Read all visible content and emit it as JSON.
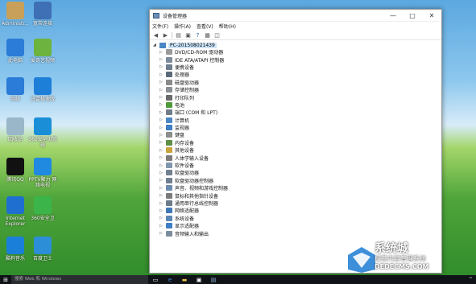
{
  "desktop": {
    "icons": [
      {
        "label": "Administr...",
        "color": "#c9a05a",
        "glyph": "user-folder"
      },
      {
        "label": "宽带连接",
        "color": "#3f6fb5",
        "glyph": "computer"
      },
      {
        "label": "此电脑",
        "color": "#2b7bd8",
        "glyph": "pc"
      },
      {
        "label": "爱奇艺视频",
        "color": "#6db33f",
        "glyph": "iqiyi"
      },
      {
        "label": "网络",
        "color": "#2b7bd8",
        "glyph": "network"
      },
      {
        "label": "迅雷极速版",
        "color": "#1e7fd8",
        "glyph": "bird"
      },
      {
        "label": "回收站",
        "color": "#9ab7c9",
        "glyph": "recycle"
      },
      {
        "label": "360安全浏览器",
        "color": "#1a8fd8",
        "glyph": "e"
      },
      {
        "label": "腾讯QQ",
        "color": "#111111",
        "glyph": "qq"
      },
      {
        "label": "PPTV聚力 网络电视",
        "color": "#1f8ae0",
        "glyph": "pptv"
      },
      {
        "label": "Internet Explorer",
        "color": "#1f6fd0",
        "glyph": "ie"
      },
      {
        "label": "360安全卫",
        "color": "#3bb54a",
        "glyph": "shield"
      },
      {
        "label": "酷狗音乐",
        "color": "#1a7fd8",
        "glyph": "kugou"
      },
      {
        "label": "百度卫士",
        "color": "#2d8ed8",
        "glyph": "shield"
      }
    ]
  },
  "window": {
    "title": "设备管理器",
    "controls": {
      "min": "—",
      "max": "□",
      "close": "✕"
    },
    "menu": [
      "文件(F)",
      "操作(A)",
      "查看(V)",
      "帮助(H)"
    ],
    "root": "PC-201508021439",
    "items": [
      {
        "label": "DVD/CD-ROM 驱动器",
        "color": "#9a9a9a"
      },
      {
        "label": "IDE ATA/ATAPI 控制器",
        "color": "#7d8c9c"
      },
      {
        "label": "便携设备",
        "color": "#6f7f8f"
      },
      {
        "label": "处理器",
        "color": "#5a6a7a"
      },
      {
        "label": "磁盘驱动器",
        "color": "#8a8a8a"
      },
      {
        "label": "存储控制器",
        "color": "#8a8f95"
      },
      {
        "label": "打印队列",
        "color": "#6a6a6a"
      },
      {
        "label": "电池",
        "color": "#4f9a3c"
      },
      {
        "label": "端口 (COM 和 LPT)",
        "color": "#707c88"
      },
      {
        "label": "计算机",
        "color": "#4a86c5"
      },
      {
        "label": "监视器",
        "color": "#3d7ec4"
      },
      {
        "label": "键盘",
        "color": "#8d8d8d"
      },
      {
        "label": "内存设备",
        "color": "#5b8f46"
      },
      {
        "label": "其他设备",
        "color": "#c9a33b"
      },
      {
        "label": "人体学输入设备",
        "color": "#7c7c7c"
      },
      {
        "label": "软件设备",
        "color": "#8096ad"
      },
      {
        "label": "软盘驱动器",
        "color": "#6f7f90"
      },
      {
        "label": "软盘驱动器控制器",
        "color": "#6f7f90"
      },
      {
        "label": "声音、视频和游戏控制器",
        "color": "#6a8bad"
      },
      {
        "label": "鼠标和其他指针设备",
        "color": "#7a7a7a"
      },
      {
        "label": "通用串行总线控制器",
        "color": "#6a7a8a"
      },
      {
        "label": "网络适配器",
        "color": "#3f78b8"
      },
      {
        "label": "系统设备",
        "color": "#5c87b5"
      },
      {
        "label": "显示适配器",
        "color": "#3d7ec4"
      },
      {
        "label": "音频输入和输出",
        "color": "#7b8d9f"
      }
    ]
  },
  "taskbar": {
    "search_placeholder": "搜索 Web 和 Windows"
  },
  "watermark": {
    "line1": "系统城",
    "line2": "绿茶内容管理系统",
    "line3": "DEDECMS.COM"
  }
}
